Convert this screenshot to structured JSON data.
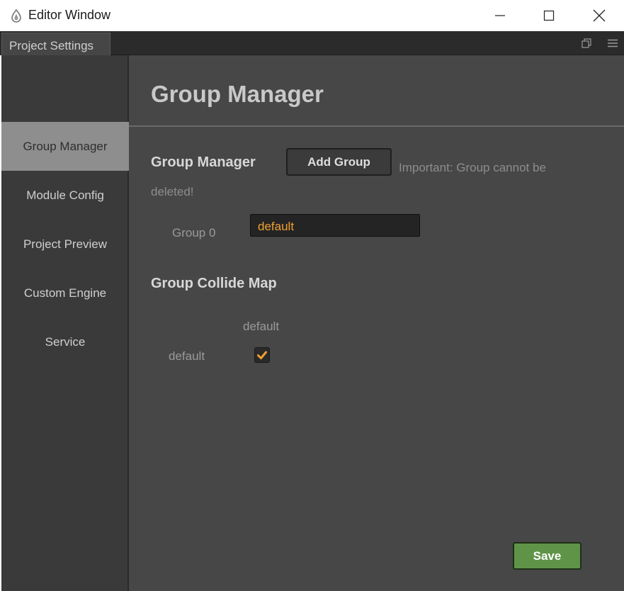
{
  "window": {
    "title": "Editor Window"
  },
  "tabs": {
    "active_tab": "Project Settings"
  },
  "sidebar": {
    "items": [
      {
        "label": "Group Manager",
        "active": true
      },
      {
        "label": "Module Config",
        "active": false
      },
      {
        "label": "Project Preview",
        "active": false
      },
      {
        "label": "Custom Engine",
        "active": false
      },
      {
        "label": "Service",
        "active": false
      }
    ]
  },
  "main": {
    "page_title": "Group Manager",
    "group_section": {
      "heading": "Group Manager",
      "add_button": "Add Group",
      "note": "Important: Group cannot be deleted!",
      "groups": [
        {
          "label": "Group 0",
          "value": "default"
        }
      ]
    },
    "collide_section": {
      "heading": "Group Collide Map",
      "column_label": "default",
      "row_label": "default",
      "checked": true
    },
    "save_button": "Save"
  },
  "colors": {
    "accent_orange": "#f0a030",
    "save_green": "#5f9448",
    "active_nav": "#8e8e8e"
  }
}
